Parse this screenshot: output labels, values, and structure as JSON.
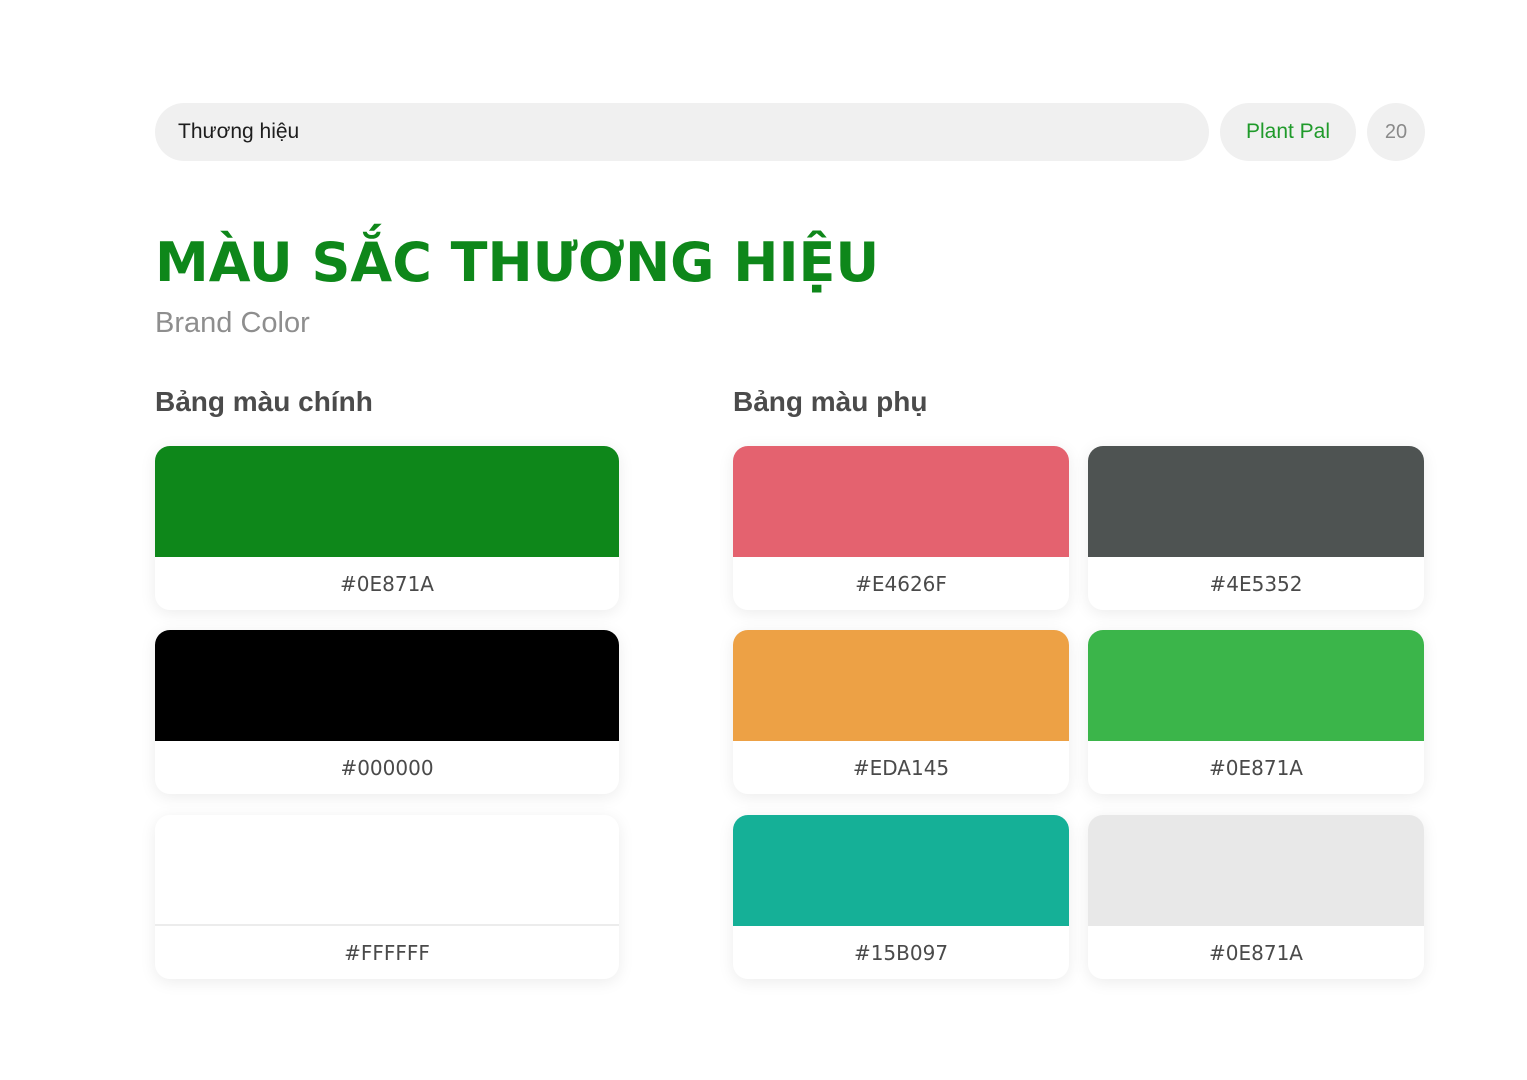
{
  "header": {
    "section_label": "Thương hiệu",
    "brand_label": "Plant Pal",
    "page_number": "20"
  },
  "title": {
    "main": "MÀU SẮC THƯƠNG HIỆU",
    "subtitle": "Brand Color"
  },
  "colors": {
    "title_green": "#0E871A",
    "brand_green": "#1F9A2A"
  },
  "primary_palette": {
    "title": "Bảng màu chính",
    "swatches": [
      {
        "code": "#0E871A",
        "color": "#0E871A"
      },
      {
        "code": "#000000",
        "color": "#000000"
      },
      {
        "code": "#FFFFFF",
        "color": "#FFFFFF"
      }
    ]
  },
  "secondary_palette": {
    "title": "Bảng màu phụ",
    "swatches": [
      {
        "code": "#E4626F",
        "color": "#E4626F"
      },
      {
        "code": "#4E5352",
        "color": "#4E5352"
      },
      {
        "code": "#EDA145",
        "color": "#EDA145"
      },
      {
        "code": "#0E871A",
        "color": "#3BB54A"
      },
      {
        "code": "#15B097",
        "color": "#15B097"
      },
      {
        "code": "#0E871A",
        "color": "#E8E8E8"
      }
    ]
  }
}
